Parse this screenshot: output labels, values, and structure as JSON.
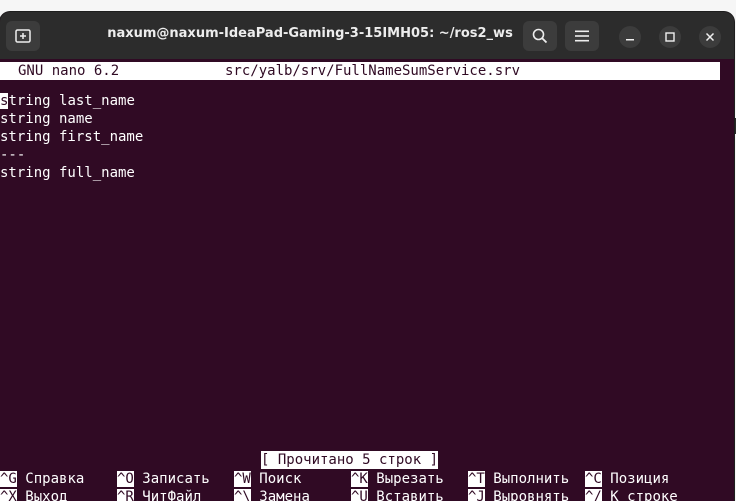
{
  "window": {
    "title": "naxum@naxum-IdeaPad-Gaming-3-15IMH05: ~/ros2_ws"
  },
  "nano": {
    "version": "GNU nano 6.2",
    "filename": "src/yalb/srv/FullNameSumService.srv",
    "cursor_char": "s",
    "lines": [
      "tring last_name",
      "string name",
      "string first_name",
      "---",
      "string full_name"
    ],
    "status": "[ Прочитано 5 строк ]",
    "shortcuts_row1": [
      {
        "key": "^G",
        "label": "Справка"
      },
      {
        "key": "^O",
        "label": "Записать"
      },
      {
        "key": "^W",
        "label": "Поиск"
      },
      {
        "key": "^K",
        "label": "Вырезать"
      },
      {
        "key": "^T",
        "label": "Выполнить"
      },
      {
        "key": "^C",
        "label": "Позиция"
      }
    ],
    "shortcuts_row2": [
      {
        "key": "^X",
        "label": "Выход"
      },
      {
        "key": "^R",
        "label": "ЧитФайл"
      },
      {
        "key": "^\\",
        "label": "Замена"
      },
      {
        "key": "^U",
        "label": "Вставить"
      },
      {
        "key": "^J",
        "label": "Выровнять"
      },
      {
        "key": "^/",
        "label": "К строке"
      }
    ]
  },
  "colors": {
    "terminal_bg": "#300a24",
    "titlebar_bg": "#2c2c2c",
    "text": "#ffffff"
  },
  "icons": {
    "new_tab": "new-tab-icon",
    "search": "search-icon",
    "menu": "hamburger-menu-icon",
    "minimize": "minimize-icon",
    "maximize": "maximize-icon",
    "close": "close-icon"
  }
}
